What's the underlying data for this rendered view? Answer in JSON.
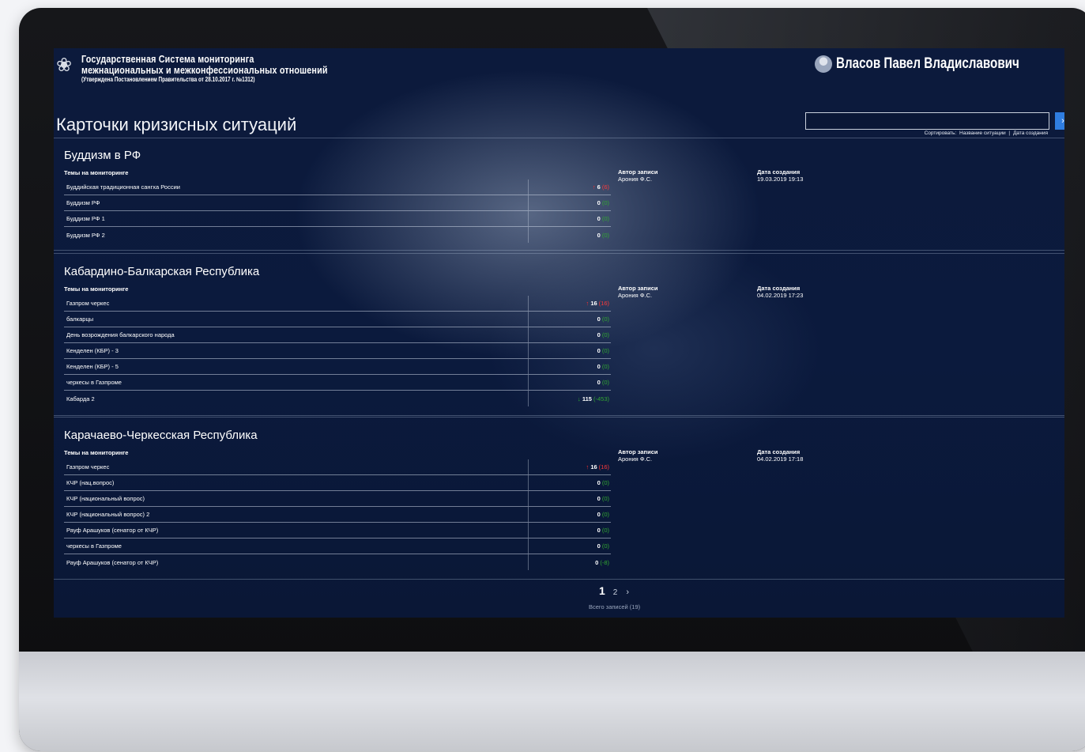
{
  "header": {
    "line1": "Государственная Система мониторинга",
    "line2": "межнациональных и межконфессиональных отношений",
    "line3": "(Утверждена Постановлением Правительства от 28.10.2017 г. №1312)",
    "user_name": "Власов Павел Владиславович"
  },
  "page_title": "Карточки кризисных ситуаций",
  "search": {
    "value": ""
  },
  "sort": {
    "label": "Сортировать:",
    "option1": "Название ситуации",
    "separator": "|",
    "option2": "Дата создания"
  },
  "cards": [
    {
      "title": "Буддизм в РФ",
      "topics_label": "Темы на мониторинге",
      "author_label": "Автор записи",
      "author": "Арония Ф.С.",
      "date_label": "Дата создания",
      "date": "19.03.2019 19:13",
      "topics": [
        {
          "name": "Буддийская традиционная сангха России",
          "arrow": "up",
          "value": "6",
          "delta": "(6)"
        },
        {
          "name": "Буддизм РФ",
          "arrow": "",
          "value": "0",
          "delta": "(0)"
        },
        {
          "name": "Буддизм РФ 1",
          "arrow": "",
          "value": "0",
          "delta": "(0)"
        },
        {
          "name": "Буддизм РФ 2",
          "arrow": "",
          "value": "0",
          "delta": "(0)"
        }
      ]
    },
    {
      "title": "Кабардино-Балкарская Республика",
      "topics_label": "Темы на мониторинге",
      "author_label": "Автор записи",
      "author": "Арония Ф.С.",
      "date_label": "Дата создания",
      "date": "04.02.2019 17:23",
      "topics": [
        {
          "name": "Газпром черкес",
          "arrow": "up",
          "value": "16",
          "delta": "(16)"
        },
        {
          "name": "балкарцы",
          "arrow": "",
          "value": "0",
          "delta": "(0)"
        },
        {
          "name": "День возрождения балкарского народа",
          "arrow": "",
          "value": "0",
          "delta": "(0)"
        },
        {
          "name": "Кенделен (КБР) - 3",
          "arrow": "",
          "value": "0",
          "delta": "(0)"
        },
        {
          "name": "Кенделен (КБР) - 5",
          "arrow": "",
          "value": "0",
          "delta": "(0)"
        },
        {
          "name": "черкесы в Газпроме",
          "arrow": "",
          "value": "0",
          "delta": "(0)"
        },
        {
          "name": "Кабарда 2",
          "arrow": "down",
          "value": "115",
          "delta": "(-453)"
        }
      ]
    },
    {
      "title": "Карачаево-Черкесская Республика",
      "topics_label": "Темы на мониторинге",
      "author_label": "Автор записи",
      "author": "Арония Ф.С.",
      "date_label": "Дата создания",
      "date": "04.02.2019 17:18",
      "topics": [
        {
          "name": "Газпром черкес",
          "arrow": "up",
          "value": "16",
          "delta": "(16)"
        },
        {
          "name": "КЧР (нац.вопрос)",
          "arrow": "",
          "value": "0",
          "delta": "(0)"
        },
        {
          "name": "КЧР (национальный вопрос)",
          "arrow": "",
          "value": "0",
          "delta": "(0)"
        },
        {
          "name": "КЧР (национальный вопрос) 2",
          "arrow": "",
          "value": "0",
          "delta": "(0)"
        },
        {
          "name": "Рауф Арашуков (сенатор от КЧР)",
          "arrow": "",
          "value": "0",
          "delta": "(0)"
        },
        {
          "name": "черкесы в Газпроме",
          "arrow": "",
          "value": "0",
          "delta": "(0)"
        },
        {
          "name": "Рауф Арашуков (сенатор от КЧР)",
          "arrow": "",
          "value": "0",
          "delta": "(-8)"
        }
      ]
    }
  ],
  "pagination": {
    "current": "1",
    "next_page": "2",
    "next_icon": "›",
    "total": "Всего записей (19)"
  },
  "icons": {
    "emblem": "emblem-icon",
    "avatar": "user-avatar-icon",
    "next": "chevron-right-icon"
  },
  "colors": {
    "up": "#ff3030",
    "down": "#2fb82f",
    "accent": "#2f7de0"
  }
}
